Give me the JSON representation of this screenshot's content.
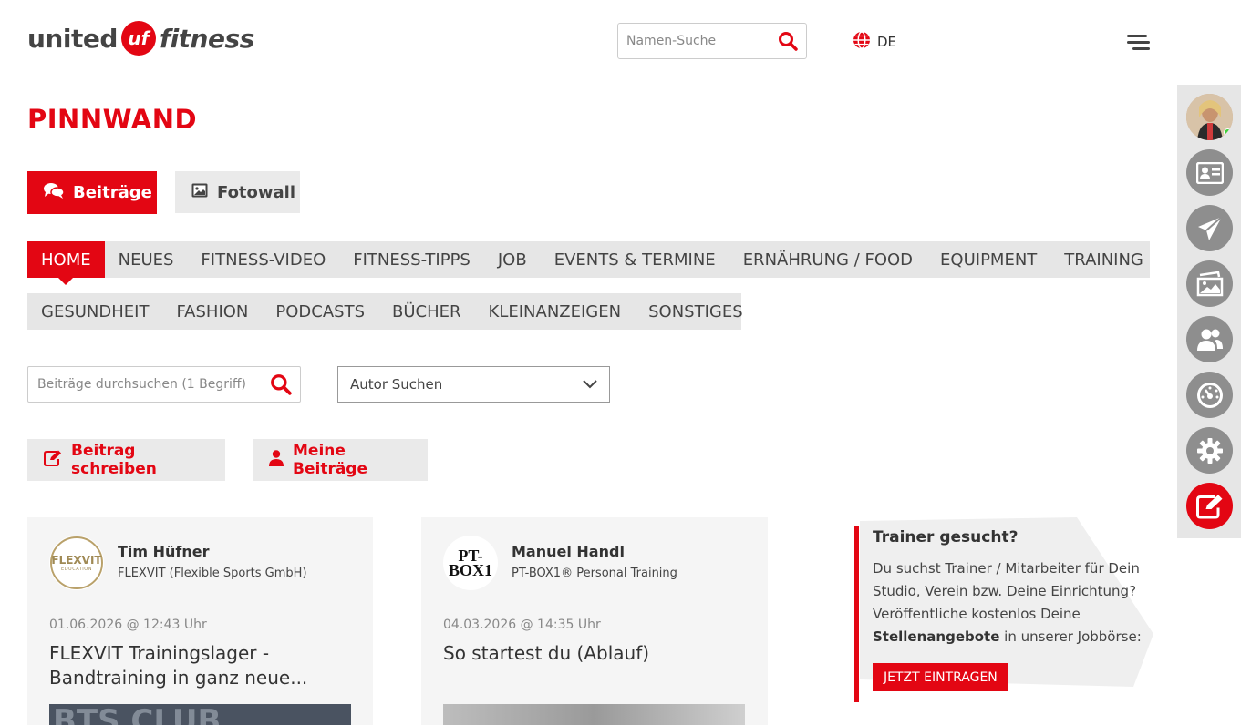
{
  "header": {
    "logo_left": "united",
    "logo_mark": "uf",
    "logo_right": "fitness",
    "name_search_placeholder": "Namen-Suche",
    "language": "DE"
  },
  "page_title": "PINNWAND",
  "main_tabs": [
    {
      "label": "Beiträge",
      "icon": "comments-icon",
      "active": true
    },
    {
      "label": "Fotowall",
      "icon": "image-icon",
      "active": false
    }
  ],
  "categories_row1": [
    "HOME",
    "NEUES",
    "FITNESS-VIDEO",
    "FITNESS-TIPPS",
    "JOB",
    "EVENTS & TERMINE",
    "ERNÄHRUNG / FOOD",
    "EQUIPMENT",
    "TRAINING"
  ],
  "categories_row2": [
    "GESUNDHEIT",
    "FASHION",
    "PODCASTS",
    "BÜCHER",
    "KLEINANZEIGEN",
    "SONSTIGES"
  ],
  "active_category": "HOME",
  "filters": {
    "post_search_placeholder": "Beiträge durchsuchen (1 Begriff)",
    "author_select_value": "Autor Suchen"
  },
  "actions": {
    "write": "Beitrag schreiben",
    "mine": "Meine Beiträge"
  },
  "posts": [
    {
      "author": "Tim Hüfner",
      "company": "FLEXVIT (Flexible Sports GmbH)",
      "avatar_text": "FLEXVIT",
      "avatar_subtext": "EDUCATION",
      "date": "01.06.2026 @ 12:43 Uhr",
      "title": "FLEXVIT Trainingslager - Bandtraining in ganz neue..."
    },
    {
      "author": "Manuel Handl",
      "company": "PT-BOX1® Personal Training",
      "avatar_text": "PT-BOX1",
      "date": "04.03.2026 @ 14:35 Uhr",
      "title": "So startest du (Ablauf)"
    }
  ],
  "promo": {
    "title": "Trainer gesucht?",
    "text_before": "Du suchst Trainer / Mitarbeiter für Dein Studio, Verein bzw. Deine Einrichtung? Veröffentliche kostenlos Deine ",
    "text_bold": "Stellenangebote",
    "text_after": " in unserer Jobbörse:",
    "cta": "JETZT EINTRAGEN"
  },
  "sidebar_icons": [
    "profile-avatar",
    "id-card-icon",
    "paper-plane-icon",
    "photo-gallery-icon",
    "users-icon",
    "dashboard-icon",
    "settings-icon",
    "edit-icon"
  ],
  "colors": {
    "accent": "#e30613",
    "tab_inactive": "#eaeaea",
    "nav_bg": "#e6e6e6",
    "sidebar_icon": "#8e8e8e"
  }
}
